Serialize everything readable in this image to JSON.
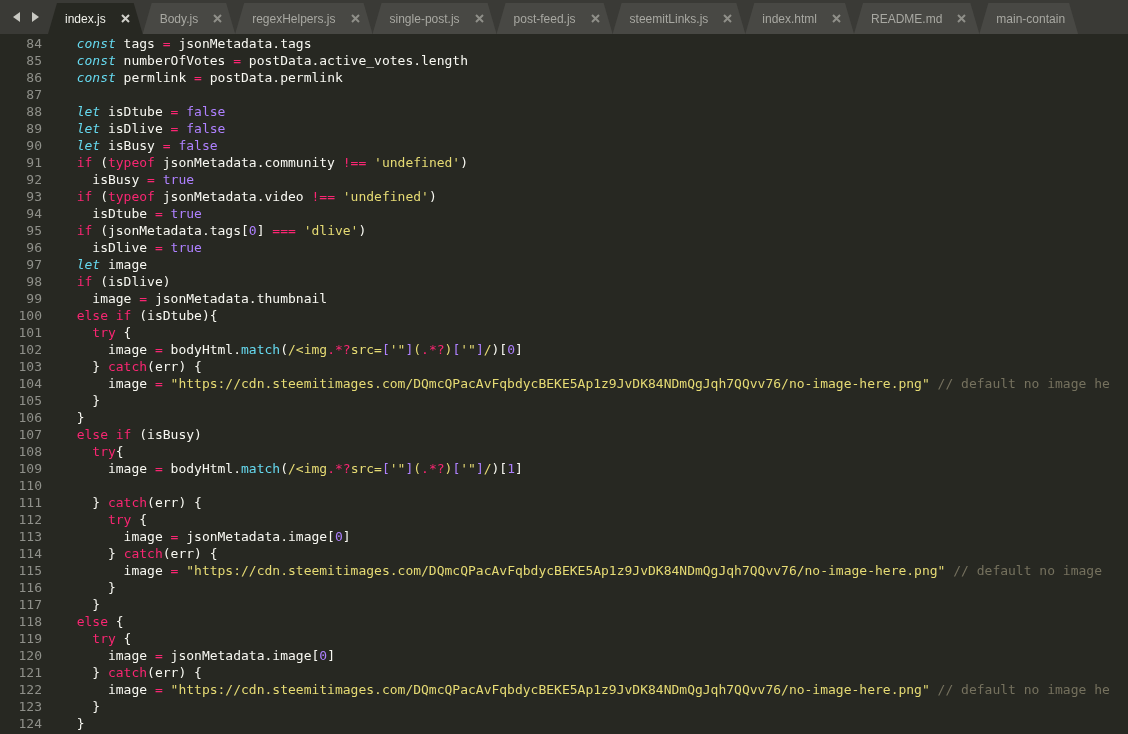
{
  "tabs": [
    {
      "label": "index.js",
      "selected": true,
      "closable": true
    },
    {
      "label": "Body.js",
      "selected": false,
      "closable": true
    },
    {
      "label": "regexHelpers.js",
      "selected": false,
      "closable": true
    },
    {
      "label": "single-post.js",
      "selected": false,
      "closable": true
    },
    {
      "label": "post-feed.js",
      "selected": false,
      "closable": true
    },
    {
      "label": "steemitLinks.js",
      "selected": false,
      "closable": true
    },
    {
      "label": "index.html",
      "selected": false,
      "closable": true
    },
    {
      "label": "README.md",
      "selected": false,
      "closable": true
    },
    {
      "label": "main-contain",
      "selected": false,
      "closable": false
    }
  ],
  "lines": [
    {
      "number": "84",
      "tokens": [
        {
          "kind": "k",
          "text": "  const"
        },
        {
          "kind": "p",
          "text": " tags "
        },
        {
          "kind": "o",
          "text": "="
        },
        {
          "kind": "p",
          "text": " jsonMetadata.tags"
        }
      ]
    },
    {
      "number": "85",
      "tokens": [
        {
          "kind": "k",
          "text": "  const"
        },
        {
          "kind": "p",
          "text": " numberOfVotes "
        },
        {
          "kind": "o",
          "text": "="
        },
        {
          "kind": "p",
          "text": " postData.active_votes.length"
        }
      ]
    },
    {
      "number": "86",
      "tokens": [
        {
          "kind": "k",
          "text": "  const"
        },
        {
          "kind": "p",
          "text": " permlink "
        },
        {
          "kind": "o",
          "text": "="
        },
        {
          "kind": "p",
          "text": " postData.permlink"
        }
      ]
    },
    {
      "number": "87"
    },
    {
      "number": "88",
      "tokens": [
        {
          "kind": "k",
          "text": "  let"
        },
        {
          "kind": "p",
          "text": " isDtube "
        },
        {
          "kind": "o",
          "text": "="
        },
        {
          "kind": "n",
          "text": " false"
        }
      ]
    },
    {
      "number": "89",
      "tokens": [
        {
          "kind": "k",
          "text": "  let"
        },
        {
          "kind": "p",
          "text": " isDlive "
        },
        {
          "kind": "o",
          "text": "="
        },
        {
          "kind": "n",
          "text": " false"
        }
      ]
    },
    {
      "number": "90",
      "tokens": [
        {
          "kind": "k",
          "text": "  let"
        },
        {
          "kind": "p",
          "text": " isBusy "
        },
        {
          "kind": "o",
          "text": "="
        },
        {
          "kind": "n",
          "text": " false"
        }
      ]
    },
    {
      "number": "91",
      "tokens": [
        {
          "kind": "c",
          "text": "  if"
        },
        {
          "kind": "p",
          "text": " ("
        },
        {
          "kind": "c",
          "text": "typeof"
        },
        {
          "kind": "p",
          "text": " jsonMetadata.community "
        },
        {
          "kind": "o",
          "text": "!=="
        },
        {
          "kind": "s",
          "text": " 'undefined'"
        },
        {
          "kind": "p",
          "text": ")"
        }
      ]
    },
    {
      "number": "92",
      "tokens": [
        {
          "kind": "p",
          "text": "    isBusy "
        },
        {
          "kind": "o",
          "text": "="
        },
        {
          "kind": "n",
          "text": " true"
        }
      ]
    },
    {
      "number": "93",
      "tokens": [
        {
          "kind": "c",
          "text": "  if"
        },
        {
          "kind": "p",
          "text": " ("
        },
        {
          "kind": "c",
          "text": "typeof"
        },
        {
          "kind": "p",
          "text": " jsonMetadata.video "
        },
        {
          "kind": "o",
          "text": "!=="
        },
        {
          "kind": "s",
          "text": " 'undefined'"
        },
        {
          "kind": "p",
          "text": ")"
        }
      ]
    },
    {
      "number": "94",
      "tokens": [
        {
          "kind": "p",
          "text": "    isDtube "
        },
        {
          "kind": "o",
          "text": "="
        },
        {
          "kind": "n",
          "text": " true"
        }
      ]
    },
    {
      "number": "95",
      "tokens": [
        {
          "kind": "c",
          "text": "  if"
        },
        {
          "kind": "p",
          "text": " (jsonMetadata.tags["
        },
        {
          "kind": "n",
          "text": "0"
        },
        {
          "kind": "p",
          "text": "] "
        },
        {
          "kind": "o",
          "text": "==="
        },
        {
          "kind": "s",
          "text": " 'dlive'"
        },
        {
          "kind": "p",
          "text": ")"
        }
      ]
    },
    {
      "number": "96",
      "tokens": [
        {
          "kind": "p",
          "text": "    isDlive "
        },
        {
          "kind": "o",
          "text": "="
        },
        {
          "kind": "n",
          "text": " true"
        }
      ]
    },
    {
      "number": "97",
      "tokens": [
        {
          "kind": "k",
          "text": "  let"
        },
        {
          "kind": "p",
          "text": " image"
        }
      ]
    },
    {
      "number": "98",
      "tokens": [
        {
          "kind": "c",
          "text": "  if"
        },
        {
          "kind": "p",
          "text": " (isDlive)"
        }
      ]
    },
    {
      "number": "99",
      "tokens": [
        {
          "kind": "p",
          "text": "    image "
        },
        {
          "kind": "o",
          "text": "="
        },
        {
          "kind": "p",
          "text": " jsonMetadata.thumbnail"
        }
      ]
    },
    {
      "number": "100",
      "tokens": [
        {
          "kind": "c",
          "text": "  else if"
        },
        {
          "kind": "p",
          "text": " (isDtube){"
        }
      ]
    },
    {
      "number": "101",
      "tokens": [
        {
          "kind": "c",
          "text": "    try"
        },
        {
          "kind": "p",
          "text": " {"
        }
      ]
    },
    {
      "number": "102",
      "tokens": [
        {
          "kind": "p",
          "text": "      image "
        },
        {
          "kind": "o",
          "text": "="
        },
        {
          "kind": "p",
          "text": " bodyHtml."
        },
        {
          "kind": "f",
          "text": "match"
        },
        {
          "kind": "p",
          "text": "("
        },
        {
          "kind": "r",
          "text": "/<img"
        },
        {
          "kind": "o",
          "text": ".*?"
        },
        {
          "kind": "r",
          "text": "src="
        },
        {
          "kind": "n",
          "text": "["
        },
        {
          "kind": "r",
          "text": "'\""
        },
        {
          "kind": "n",
          "text": "]"
        },
        {
          "kind": "r",
          "text": "("
        },
        {
          "kind": "o",
          "text": ".*?"
        },
        {
          "kind": "r",
          "text": ")"
        },
        {
          "kind": "n",
          "text": "["
        },
        {
          "kind": "r",
          "text": "'\""
        },
        {
          "kind": "n",
          "text": "]"
        },
        {
          "kind": "r",
          "text": "/"
        },
        {
          "kind": "p",
          "text": ")["
        },
        {
          "kind": "n",
          "text": "0"
        },
        {
          "kind": "p",
          "text": "]"
        }
      ]
    },
    {
      "number": "103",
      "tokens": [
        {
          "kind": "p",
          "text": "    } "
        },
        {
          "kind": "c",
          "text": "catch"
        },
        {
          "kind": "p",
          "text": "(err) {"
        }
      ]
    },
    {
      "number": "104",
      "tokens": [
        {
          "kind": "p",
          "text": "      image "
        },
        {
          "kind": "o",
          "text": "="
        },
        {
          "kind": "s",
          "text": " \"https://cdn.steemitimages.com/DQmcQPacAvFqbdycBEKE5Ap1z9JvDK84NDmQgJqh7QQvv76/no-image-here.png\""
        },
        {
          "kind": "m",
          "text": " // default no image he"
        }
      ]
    },
    {
      "number": "105",
      "tokens": [
        {
          "kind": "p",
          "text": "    }"
        }
      ]
    },
    {
      "number": "106",
      "tokens": [
        {
          "kind": "p",
          "text": "  }"
        }
      ]
    },
    {
      "number": "107",
      "tokens": [
        {
          "kind": "c",
          "text": "  else if"
        },
        {
          "kind": "p",
          "text": " (isBusy)"
        }
      ]
    },
    {
      "number": "108",
      "tokens": [
        {
          "kind": "c",
          "text": "    try"
        },
        {
          "kind": "p",
          "text": "{"
        }
      ]
    },
    {
      "number": "109",
      "tokens": [
        {
          "kind": "p",
          "text": "      image "
        },
        {
          "kind": "o",
          "text": "="
        },
        {
          "kind": "p",
          "text": " bodyHtml."
        },
        {
          "kind": "f",
          "text": "match"
        },
        {
          "kind": "p",
          "text": "("
        },
        {
          "kind": "r",
          "text": "/<img"
        },
        {
          "kind": "o",
          "text": ".*?"
        },
        {
          "kind": "r",
          "text": "src="
        },
        {
          "kind": "n",
          "text": "["
        },
        {
          "kind": "r",
          "text": "'\""
        },
        {
          "kind": "n",
          "text": "]"
        },
        {
          "kind": "r",
          "text": "("
        },
        {
          "kind": "o",
          "text": ".*?"
        },
        {
          "kind": "r",
          "text": ")"
        },
        {
          "kind": "n",
          "text": "["
        },
        {
          "kind": "r",
          "text": "'\""
        },
        {
          "kind": "n",
          "text": "]"
        },
        {
          "kind": "r",
          "text": "/"
        },
        {
          "kind": "p",
          "text": ")["
        },
        {
          "kind": "n",
          "text": "1"
        },
        {
          "kind": "p",
          "text": "]"
        }
      ]
    },
    {
      "number": "110"
    },
    {
      "number": "111",
      "tokens": [
        {
          "kind": "p",
          "text": "    } "
        },
        {
          "kind": "c",
          "text": "catch"
        },
        {
          "kind": "p",
          "text": "(err) {"
        }
      ]
    },
    {
      "number": "112",
      "tokens": [
        {
          "kind": "c",
          "text": "      try"
        },
        {
          "kind": "p",
          "text": " {"
        }
      ]
    },
    {
      "number": "113",
      "tokens": [
        {
          "kind": "p",
          "text": "        image "
        },
        {
          "kind": "o",
          "text": "="
        },
        {
          "kind": "p",
          "text": " jsonMetadata.image["
        },
        {
          "kind": "n",
          "text": "0"
        },
        {
          "kind": "p",
          "text": "]"
        }
      ]
    },
    {
      "number": "114",
      "tokens": [
        {
          "kind": "p",
          "text": "      } "
        },
        {
          "kind": "c",
          "text": "catch"
        },
        {
          "kind": "p",
          "text": "(err) {"
        }
      ]
    },
    {
      "number": "115",
      "tokens": [
        {
          "kind": "p",
          "text": "        image "
        },
        {
          "kind": "o",
          "text": "="
        },
        {
          "kind": "s",
          "text": " \"https://cdn.steemitimages.com/DQmcQPacAvFqbdycBEKE5Ap1z9JvDK84NDmQgJqh7QQvv76/no-image-here.png\""
        },
        {
          "kind": "m",
          "text": " // default no image"
        }
      ]
    },
    {
      "number": "116",
      "tokens": [
        {
          "kind": "p",
          "text": "      }"
        }
      ]
    },
    {
      "number": "117",
      "tokens": [
        {
          "kind": "p",
          "text": "    }"
        }
      ]
    },
    {
      "number": "118",
      "tokens": [
        {
          "kind": "c",
          "text": "  else"
        },
        {
          "kind": "p",
          "text": " {"
        }
      ]
    },
    {
      "number": "119",
      "tokens": [
        {
          "kind": "c",
          "text": "    try"
        },
        {
          "kind": "p",
          "text": " {"
        }
      ]
    },
    {
      "number": "120",
      "tokens": [
        {
          "kind": "p",
          "text": "      image "
        },
        {
          "kind": "o",
          "text": "="
        },
        {
          "kind": "p",
          "text": " jsonMetadata.image["
        },
        {
          "kind": "n",
          "text": "0"
        },
        {
          "kind": "p",
          "text": "]"
        }
      ]
    },
    {
      "number": "121",
      "tokens": [
        {
          "kind": "p",
          "text": "    } "
        },
        {
          "kind": "c",
          "text": "catch"
        },
        {
          "kind": "p",
          "text": "(err) {"
        }
      ]
    },
    {
      "number": "122",
      "tokens": [
        {
          "kind": "p",
          "text": "      image "
        },
        {
          "kind": "o",
          "text": "="
        },
        {
          "kind": "s",
          "text": " \"https://cdn.steemitimages.com/DQmcQPacAvFqbdycBEKE5Ap1z9JvDK84NDmQgJqh7QQvv76/no-image-here.png\""
        },
        {
          "kind": "m",
          "text": " // default no image he"
        }
      ]
    },
    {
      "number": "123",
      "tokens": [
        {
          "kind": "p",
          "text": "    }"
        }
      ]
    },
    {
      "number": "124",
      "tokens": [
        {
          "kind": "p",
          "text": "  }"
        }
      ]
    }
  ]
}
